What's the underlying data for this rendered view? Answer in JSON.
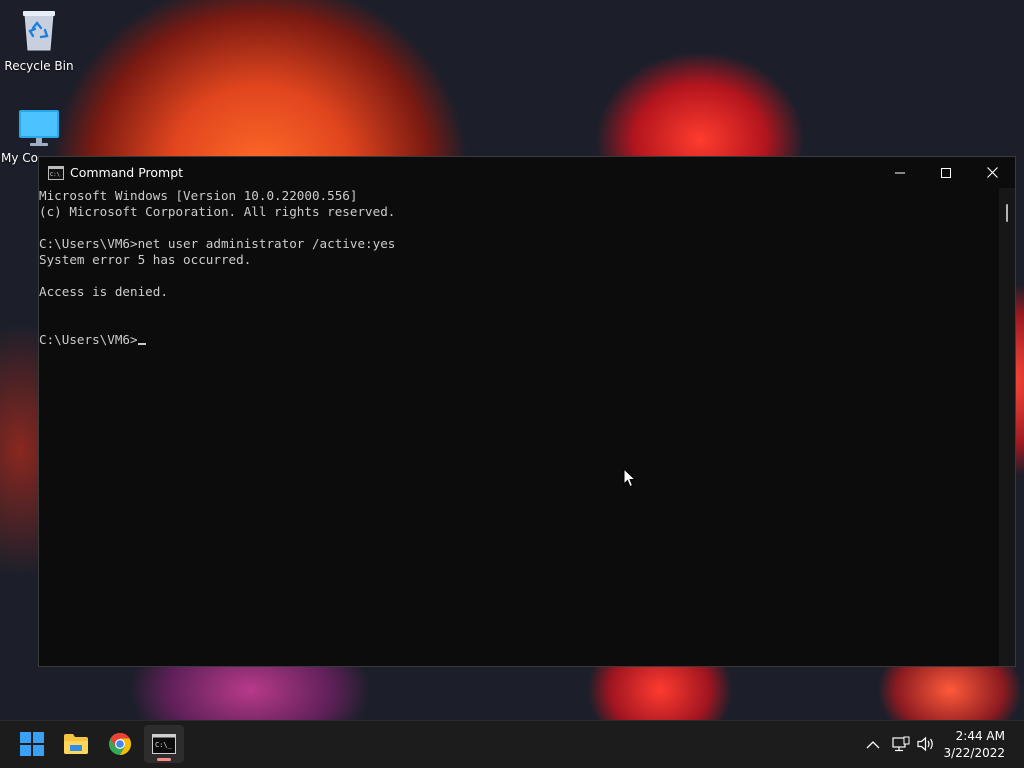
{
  "desktop": {
    "icons": [
      {
        "label": "Recycle Bin",
        "icon": "recycle-bin-icon"
      },
      {
        "label": "My Co",
        "icon": "monitor-icon"
      }
    ]
  },
  "window": {
    "title": "Command Prompt",
    "app_icon": "cmd-icon",
    "controls": {
      "minimize": "minimize-icon",
      "maximize": "maximize-icon",
      "close": "close-icon"
    },
    "console_lines": [
      "Microsoft Windows [Version 10.0.22000.556]",
      "(c) Microsoft Corporation. All rights reserved.",
      "",
      "C:\\Users\\VM6>net user administrator /active:yes",
      "System error 5 has occurred.",
      "",
      "Access is denied.",
      "",
      ""
    ],
    "prompt": "C:\\Users\\VM6>",
    "text_color": "#cccccc",
    "background_color": "#0c0c0c"
  },
  "taskbar": {
    "apps": [
      {
        "name": "Start",
        "icon": "windows-start-icon",
        "active": false
      },
      {
        "name": "File Explorer",
        "icon": "folder-icon",
        "active": false
      },
      {
        "name": "Google Chrome",
        "icon": "chrome-icon",
        "active": false
      },
      {
        "name": "Command Prompt",
        "icon": "cmd-icon",
        "active": true
      }
    ],
    "tray": {
      "icons": [
        "chevron-up-icon",
        "network-icon",
        "volume-icon"
      ],
      "time": "2:44 AM",
      "date": "3/22/2022"
    },
    "accent_color": "#0078d4"
  }
}
